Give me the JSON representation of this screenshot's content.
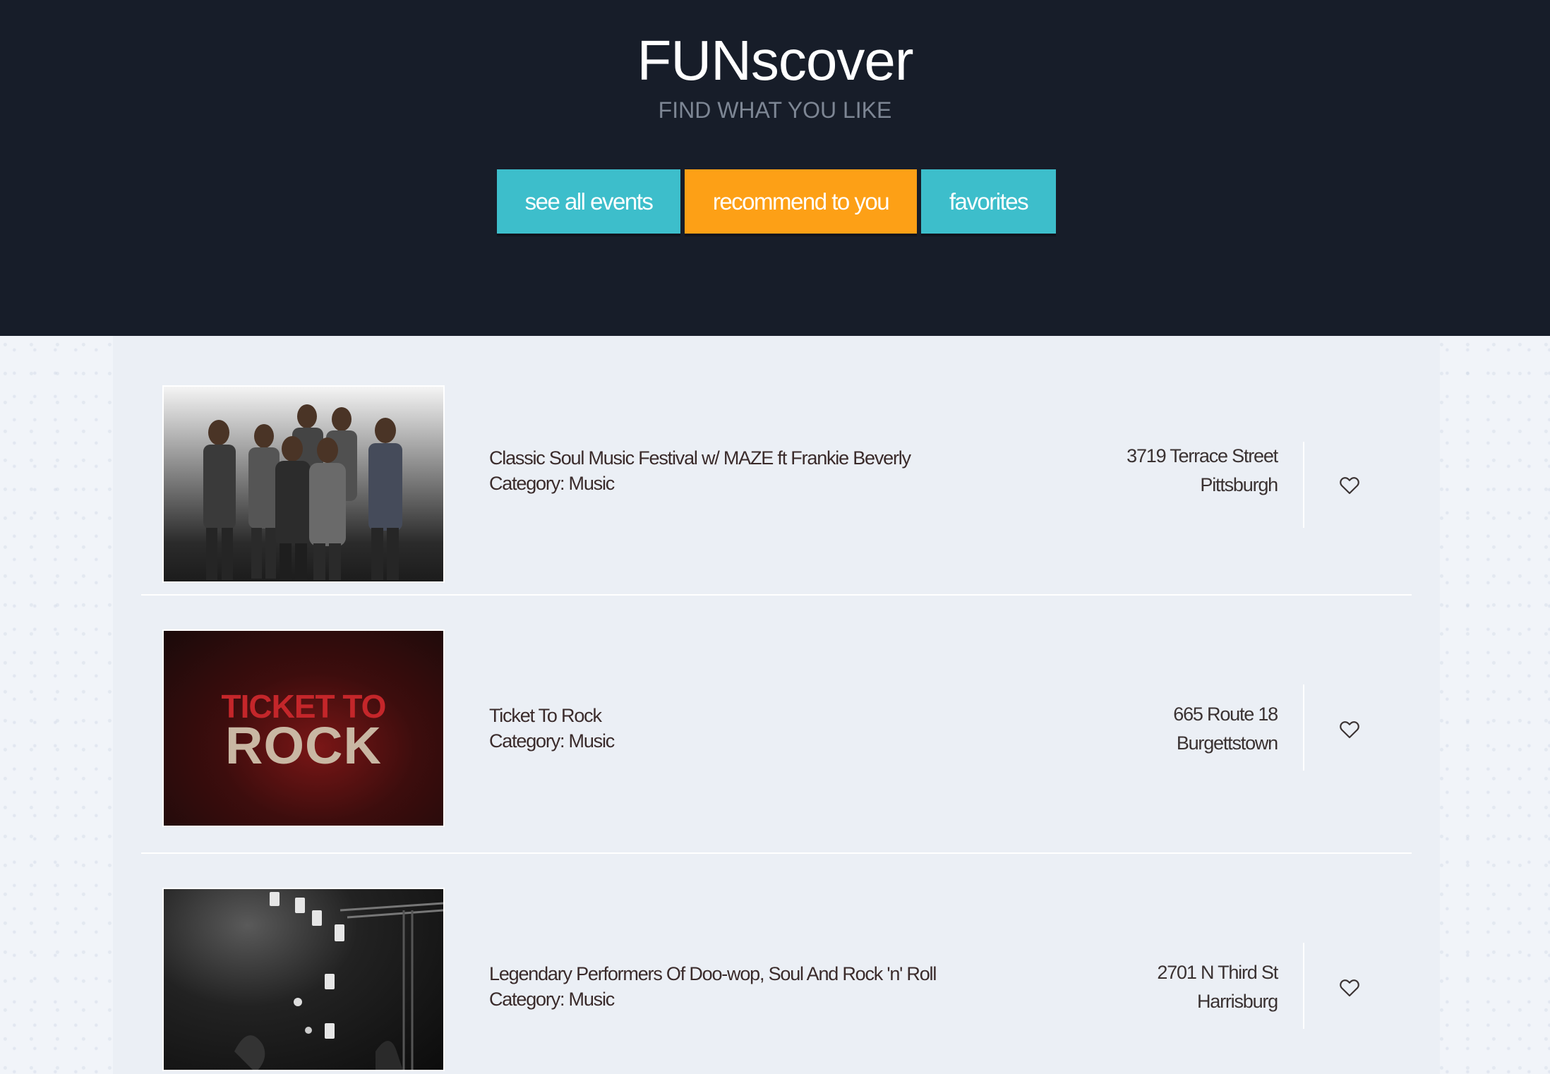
{
  "site": {
    "title": "FUNscover",
    "subtitle": "FIND WHAT YOU LIKE"
  },
  "nav": {
    "items": [
      {
        "label": "see all events",
        "color": "#3dbecb"
      },
      {
        "label": "recommend to you",
        "color": "#fda016",
        "active": true
      },
      {
        "label": "favorites",
        "color": "#3dbecb"
      }
    ]
  },
  "colors": {
    "header_bg": "#171d29",
    "accent_teal": "#3dbecb",
    "accent_orange": "#fda016"
  },
  "events": [
    {
      "name": "Classic Soul Music Festival w/ MAZE ft Frankie Beverly",
      "category": "Category: Music",
      "address_line1": "3719 Terrace Street",
      "address_line2": "Pittsburgh",
      "favorite_icon": "heart-outline-icon"
    },
    {
      "name": "Ticket To Rock",
      "category": "Category: Music",
      "address_line1": "665 Route 18",
      "address_line2": "Burgettstown",
      "thumb_text_line1": "TICKET TO",
      "thumb_text_line2": "ROCK",
      "favorite_icon": "heart-outline-icon"
    },
    {
      "name": "Legendary Performers Of Doo-wop, Soul And Rock 'n' Roll",
      "category": "Category: Music",
      "address_line1": "2701 N Third St",
      "address_line2": "Harrisburg",
      "favorite_icon": "heart-outline-icon"
    }
  ]
}
